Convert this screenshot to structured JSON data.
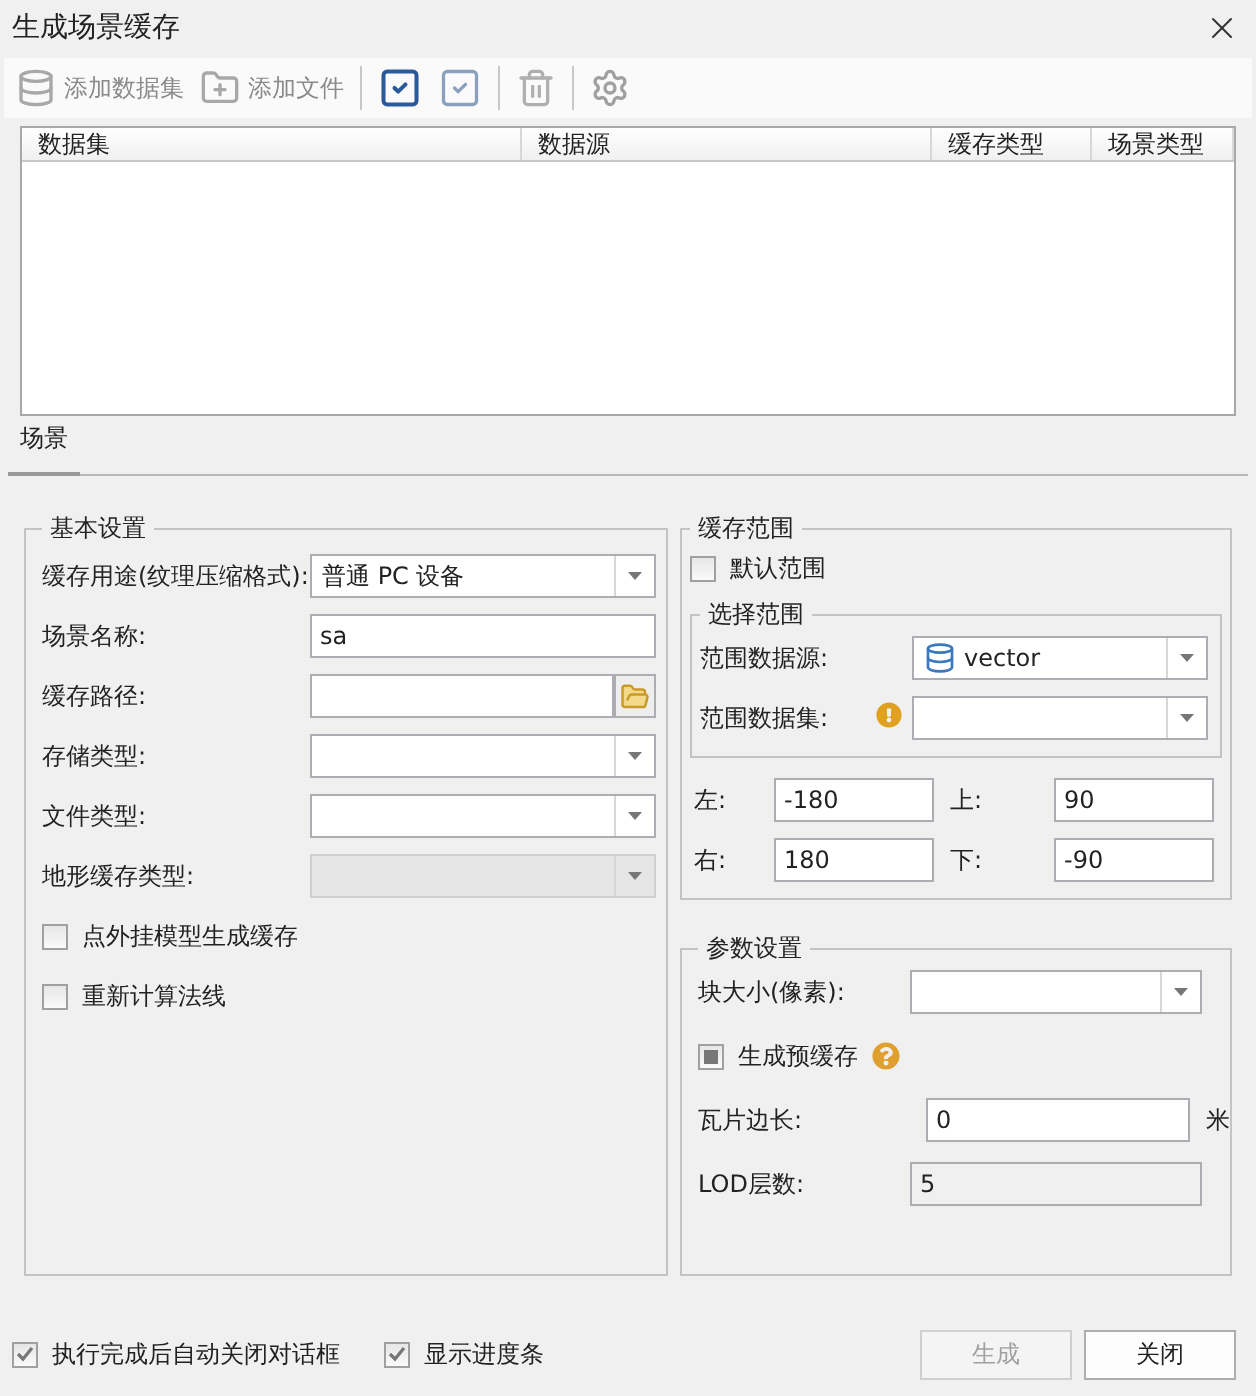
{
  "window": {
    "title": "生成场景缓存"
  },
  "toolbar": [
    {
      "kind": "add-dataset",
      "label": "添加数据集",
      "disabled": true
    },
    {
      "kind": "add-file",
      "label": "添加文件",
      "disabled": true
    },
    {
      "kind": "select-all",
      "disabled": false
    },
    {
      "kind": "select-invert",
      "disabled": false
    },
    {
      "kind": "delete",
      "disabled": true
    },
    {
      "kind": "settings",
      "disabled": true
    }
  ],
  "table": {
    "columns": [
      "数据集",
      "数据源",
      "缓存类型",
      "场景类型"
    ]
  },
  "tabs": [
    {
      "label": "场景",
      "selected": true
    }
  ],
  "basic_settings": {
    "title": "基本设置",
    "fields": [
      {
        "kind": "combo",
        "label": "缓存用途(纹理压缩格式):",
        "value": "普通 PC 设备",
        "disabled": false
      },
      {
        "kind": "text",
        "label": "场景名称:",
        "value": "sa",
        "disabled": false
      },
      {
        "kind": "path",
        "label": "缓存路径:",
        "disabled": false
      },
      {
        "kind": "combo",
        "label": "存储类型:",
        "disabled": false
      },
      {
        "kind": "combo",
        "label": "文件类型:",
        "disabled": false
      },
      {
        "kind": "combo",
        "label": "地形缓存类型:",
        "disabled": true
      }
    ],
    "options": [
      {
        "label": "点外挂模型生成缓存",
        "checked": false
      },
      {
        "label": "重新计算法线",
        "checked": false
      }
    ]
  },
  "cache_range": {
    "title": "缓存范围",
    "default_range": {
      "label": "默认范围",
      "checked": false
    },
    "select_range": {
      "title": "选择范围",
      "source": {
        "label": "范围数据源:",
        "value": "vector"
      },
      "dataset": {
        "label": "范围数据集:",
        "warning": true
      }
    },
    "bounds": [
      {
        "label": "左:",
        "value": "-180"
      },
      {
        "label": "上:",
        "value": "90"
      },
      {
        "label": "右:",
        "value": "180"
      },
      {
        "label": "下:",
        "value": "-90"
      }
    ]
  },
  "parameters": {
    "title": "参数设置",
    "block_size": {
      "label": "块大小(像素):"
    },
    "pre_cache": {
      "label": "生成预缓存",
      "indeterminate": true,
      "help": true
    },
    "tile_side": {
      "label": "瓦片边长:",
      "value": "0",
      "unit": "米"
    },
    "lod": {
      "label": "LOD层数:",
      "value": "5",
      "disabled": true
    }
  },
  "footer": {
    "options": [
      {
        "label": "执行完成后自动关闭对话框",
        "checked": true
      },
      {
        "label": "显示进度条",
        "checked": true
      }
    ],
    "buttons": [
      {
        "label": "生成",
        "disabled": true
      },
      {
        "label": "关闭",
        "disabled": false
      }
    ]
  }
}
